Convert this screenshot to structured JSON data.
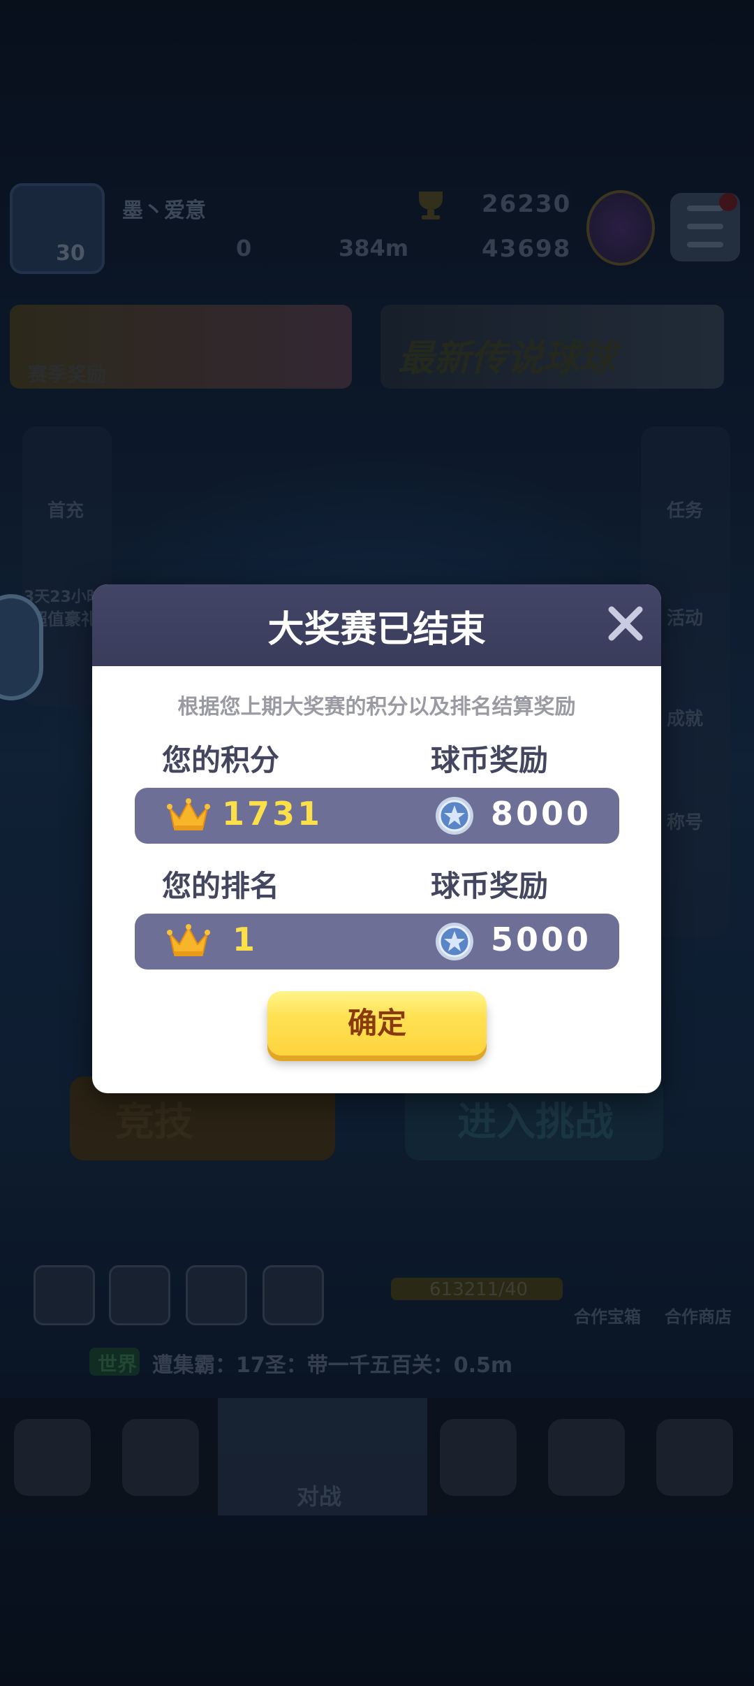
{
  "background": {
    "player": {
      "level": "30",
      "name": "墨丶爱意",
      "trophies": "26230",
      "resource_a": "0",
      "distance": "384m",
      "gems": "43698"
    },
    "banners": {
      "left_label": "赛季奖励",
      "right_label": "最新传说球球"
    },
    "side_left": [
      "首充",
      "3天23小时",
      "超值豪礼"
    ],
    "side_right": [
      "任务",
      "活动",
      "成就",
      "称号"
    ],
    "mode_buttons": {
      "left": "竞技",
      "right": "进入挑战"
    },
    "progress_text": "613211/40",
    "shops": [
      "合作宝箱",
      "合作商店"
    ],
    "chat": {
      "channel": "世界",
      "message": "遭集霸：17圣：带一千五百关：0.5m"
    },
    "nav_active_label": "对战"
  },
  "dialog": {
    "title": "大奖赛已结束",
    "subtitle": "根据您上期大奖赛的积分以及排名结算奖励",
    "score_label": "您的积分",
    "score_reward_label": "球币奖励",
    "score_value": "1731",
    "score_reward_value": "8000",
    "rank_label": "您的排名",
    "rank_reward_label": "球币奖励",
    "rank_value": "1",
    "rank_reward_value": "5000",
    "confirm_label": "确定"
  },
  "colors": {
    "header": "#434566",
    "row": "#6e6f96",
    "score_text": "#fce04a",
    "button": "#ffe152",
    "button_text": "#8a3b0e"
  },
  "icons": [
    "crown-icon",
    "coin-icon",
    "close-icon",
    "trophy-icon",
    "menu-icon"
  ]
}
